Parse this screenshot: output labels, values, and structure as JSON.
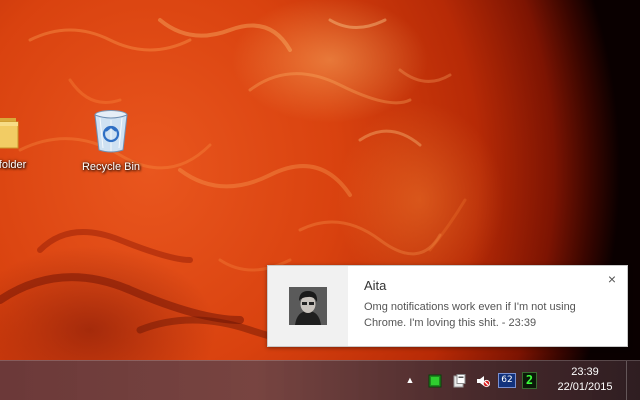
{
  "desktop": {
    "icons": [
      {
        "label": "New folder",
        "icon": "folder-icon"
      },
      {
        "label": "Recycle Bin",
        "icon": "recycle-bin-icon"
      }
    ]
  },
  "notification": {
    "title": "Aita",
    "message": "Omg notifications work even if I'm not using Chrome. I'm loving this shit. - 23:39",
    "close_glyph": "×",
    "avatar": "avatar-photo"
  },
  "taskbar": {
    "tray": {
      "chevron_glyph": "▲",
      "icons": [
        "show-hidden-icons-icon",
        "green-tray-icon",
        "device-icon",
        "volume-muted-icon",
        "badge-icon",
        "green-digit-icon"
      ],
      "badge_text": "62",
      "green_digit": "2"
    },
    "clock": {
      "time": "23:39",
      "date": "22/01/2015"
    }
  },
  "colors": {
    "wallpaper": "#d9420f",
    "toast_background": "#ffffff",
    "toast_image_pane": "#f1f1f1",
    "taskbar": "#5f2828",
    "tray_badge": "#12327c",
    "tray_green": "#3cff3c"
  }
}
